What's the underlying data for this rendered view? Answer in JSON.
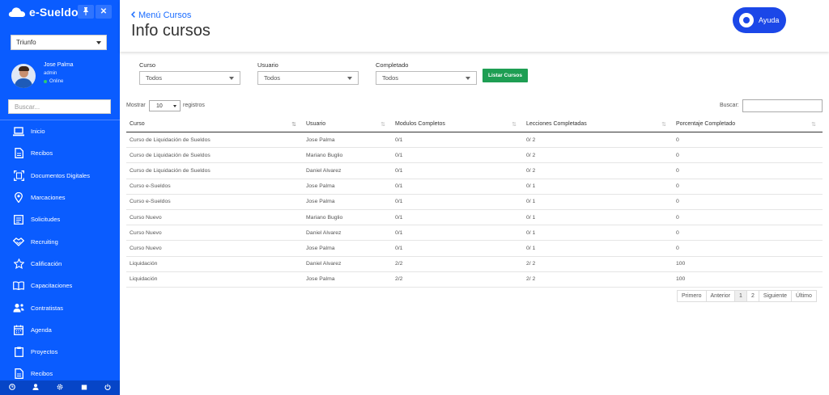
{
  "app": {
    "brand": "e-Sueldos",
    "company": "Triunfo",
    "user": {
      "name": "Jose Palma",
      "role": "admin",
      "status": "Online"
    },
    "search_placeholder": "Buscar...",
    "nav": [
      {
        "label": "Inicio",
        "icon": "laptop-icon"
      },
      {
        "label": "Recibos",
        "icon": "document-icon"
      },
      {
        "label": "Documentos Digitales",
        "icon": "scan-document-icon"
      },
      {
        "label": "Marcaciones",
        "icon": "location-pin-icon"
      },
      {
        "label": "Solicitudes",
        "icon": "form-icon"
      },
      {
        "label": "Recruiting",
        "icon": "handshake-icon"
      },
      {
        "label": "Calificación",
        "icon": "star-icon"
      },
      {
        "label": "Capacitaciones",
        "icon": "book-icon"
      },
      {
        "label": "Contratistas",
        "icon": "users-icon"
      },
      {
        "label": "Agenda",
        "icon": "calendar-icon"
      },
      {
        "label": "Proyectos",
        "icon": "clipboard-icon"
      },
      {
        "label": "Recibos",
        "icon": "document-icon"
      }
    ],
    "footer_icons": [
      "clock-icon",
      "user-icon",
      "gear-icon",
      "calendar-icon",
      "power-icon"
    ]
  },
  "header": {
    "back_label": "Menú Cursos",
    "title": "Info cursos",
    "help_label": "Ayuda"
  },
  "filters": {
    "course_label": "Curso",
    "course_value": "Todos",
    "user_label": "Usuario",
    "user_value": "Todos",
    "completed_label": "Completado",
    "completed_value": "Todos",
    "list_button": "Listar Cursos"
  },
  "table_controls": {
    "show_label": "Mostrar",
    "page_size": "10",
    "records_label": "registros",
    "search_label": "Buscar:"
  },
  "table": {
    "headers": [
      "Curso",
      "Usuario",
      "Modulos Completos",
      "Lecciones Completadas",
      "Porcentaje Completado"
    ],
    "rows": [
      [
        "Curso de Liquidación de Sueldos",
        "Jose Palma",
        "0/1",
        "0/ 2",
        "0"
      ],
      [
        "Curso de Liquidación de Sueldos",
        "Mariano Buglio",
        "0/1",
        "0/ 2",
        "0"
      ],
      [
        "Curso de Liquidación de Sueldos",
        "Daniel Alvarez",
        "0/1",
        "0/ 2",
        "0"
      ],
      [
        "Curso e-Sueldos",
        "Jose Palma",
        "0/1",
        "0/ 1",
        "0"
      ],
      [
        "Curso e-Sueldos",
        "Jose Palma",
        "0/1",
        "0/ 1",
        "0"
      ],
      [
        "Curso Nuevo",
        "Mariano Buglio",
        "0/1",
        "0/ 1",
        "0"
      ],
      [
        "Curso Nuevo",
        "Daniel Alvarez",
        "0/1",
        "0/ 1",
        "0"
      ],
      [
        "Curso Nuevo",
        "Jose Palma",
        "0/1",
        "0/ 1",
        "0"
      ],
      [
        "Liquidación",
        "Daniel Alvarez",
        "2/2",
        "2/ 2",
        "100"
      ],
      [
        "Liquidación",
        "Jose Palma",
        "2/2",
        "2/ 2",
        "100"
      ]
    ]
  },
  "pagination": {
    "first": "Primero",
    "prev": "Anterior",
    "pages": [
      "1",
      "2"
    ],
    "active_page": "1",
    "next": "Siguiente",
    "last": "Último"
  },
  "colors": {
    "sidebar": "#0a5cff",
    "accent": "#1a6cff",
    "help_button": "#1b47e8",
    "list_button": "#1e9e53"
  }
}
